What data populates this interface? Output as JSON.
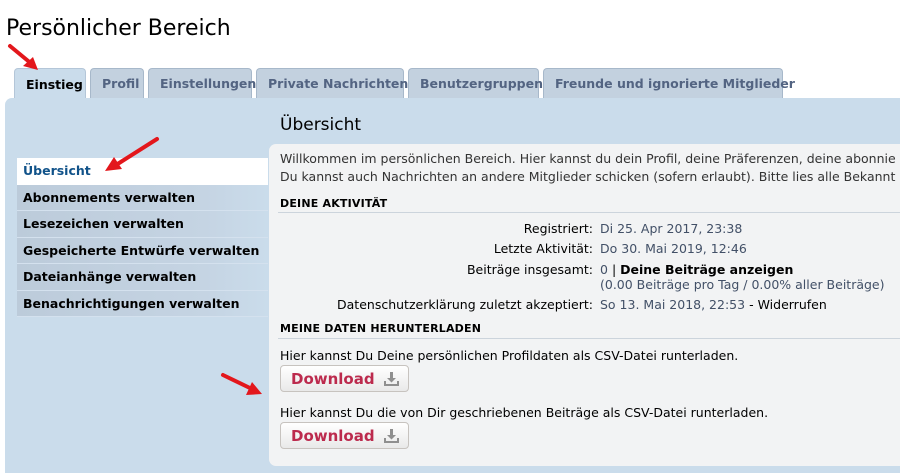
{
  "page_title": "Persönlicher Bereich",
  "tabs": [
    {
      "label": "Einstieg",
      "active": true
    },
    {
      "label": "Profil"
    },
    {
      "label": "Einstellungen"
    },
    {
      "label": "Private Nachrichten"
    },
    {
      "label": "Benutzergruppen"
    },
    {
      "label": "Freunde und ignorierte Mitglieder"
    }
  ],
  "sidebar": {
    "items": [
      {
        "label": "Übersicht",
        "active": true
      },
      {
        "label": "Abonnements verwalten"
      },
      {
        "label": "Lesezeichen verwalten"
      },
      {
        "label": "Gespeicherte Entwürfe verwalten"
      },
      {
        "label": "Dateianhänge verwalten"
      },
      {
        "label": "Benachrichtigungen verwalten"
      }
    ]
  },
  "main": {
    "title": "Übersicht",
    "intro_line1": "Willkommen im persönlichen Bereich. Hier kannst du dein Profil, deine Präferenzen, deine abonnie",
    "intro_line2": "Du kannst auch Nachrichten an andere Mitglieder schicken (sofern erlaubt). Bitte lies alle Bekannt",
    "activity": {
      "heading": "DEINE AKTIVITÄT",
      "registered_label": "Registriert:",
      "registered_value": "Di 25. Apr 2017, 23:38",
      "last_active_label": "Letzte Aktivität:",
      "last_active_value": "Do 30. Mai 2019, 12:46",
      "posts_label": "Beiträge insgesamt:",
      "posts_count": "0",
      "posts_separator": "|",
      "posts_link": "Deine Beiträge anzeigen",
      "posts_stats": "(0.00 Beiträge pro Tag / 0.00% aller Beiträge)",
      "privacy_label": "Datenschutzerklärung zuletzt akzeptiert:",
      "privacy_value": "So 13. Mai 2018, 22:53",
      "privacy_dash": "-",
      "privacy_revoke": "Widerrufen"
    },
    "download": {
      "heading": "MEINE DATEN HERUNTERLADEN",
      "profile_desc": "Hier kannst Du Deine persönlichen Profildaten als CSV-Datei runterladen.",
      "profile_button": "Download",
      "posts_desc": "Hier kannst Du die von Dir geschriebenen Beiträge als CSV-Datei runterladen.",
      "posts_button": "Download"
    }
  },
  "colors": {
    "panel": "#cadceb",
    "tab": "#c3d1df",
    "content_bg": "#f2f3f4",
    "accent_red": "#bc2a4d",
    "annotation_arrow": "#e3171c"
  }
}
